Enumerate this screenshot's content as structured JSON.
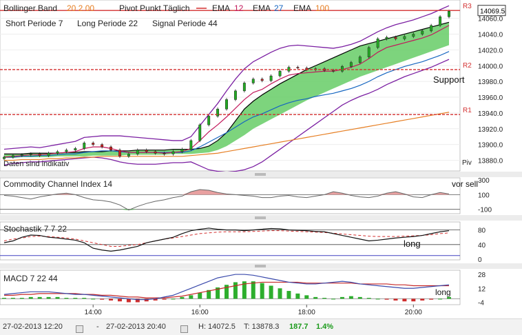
{
  "header": {
    "bollinger_label": "Bollinger Band",
    "bollinger_params": "20  2.00",
    "pivot_label": "Pivot Punkt  Täglich",
    "ema_labels": [
      "EMA",
      "EMA",
      "EMA"
    ],
    "ema_values": [
      "12",
      "27",
      "100"
    ],
    "params_line": [
      "Short Periode  7",
      "Long Periode  22",
      "Signal Periode  44"
    ],
    "indicative_note": "Daten sind indikativ",
    "piv_label": "Piv"
  },
  "colors": {
    "up_candle": "#22aa22",
    "down_candle": "#cc2222",
    "cloud": "#66cc66",
    "bollinger": "#7b1fa2",
    "pivot": "#d32f2f",
    "ema12": "#c2185b",
    "ema27": "#1565c0",
    "ema100": "#e67e22",
    "cci_fill": "#e8a0a0",
    "macd_pos": "#22aa22",
    "macd_neg": "#cc2222"
  },
  "chart_data": [
    {
      "type": "line",
      "name_hint": "price",
      "x_ticks": [
        "14:00",
        "16:00",
        "18:00",
        "20:00"
      ],
      "y_ticks": [
        "14060.0",
        "14040.0",
        "14020.0",
        "14000.0",
        "13980.0",
        "13960.0",
        "13940.0",
        "13920.0",
        "13900.0",
        "13880.0"
      ],
      "ylim": [
        13870,
        14078
      ],
      "last_price": "14069.5",
      "pivot_levels": [
        {
          "label": "R3",
          "value": 14070
        },
        {
          "label": "R2",
          "value": 13995
        },
        {
          "label": "R1",
          "value": 13938
        }
      ],
      "annotations": [
        "Support"
      ],
      "x_time": [
        "12:20",
        "12:30",
        "12:40",
        "12:50",
        "13:00",
        "13:10",
        "13:20",
        "13:30",
        "13:40",
        "13:50",
        "14:00",
        "14:10",
        "14:20",
        "14:30",
        "14:40",
        "14:50",
        "15:00",
        "15:10",
        "15:20",
        "15:30",
        "15:40",
        "15:50",
        "16:00",
        "16:10",
        "16:20",
        "16:30",
        "16:40",
        "16:50",
        "17:00",
        "17:10",
        "17:20",
        "17:30",
        "17:40",
        "17:50",
        "18:00",
        "18:10",
        "18:20",
        "18:30",
        "18:40",
        "18:50",
        "19:00",
        "19:10",
        "19:20",
        "19:30",
        "19:40",
        "19:50",
        "20:00",
        "20:10",
        "20:20",
        "20:30",
        "20:40"
      ],
      "close": [
        13884,
        13886,
        13887,
        13888,
        13886,
        13889,
        13891,
        13893,
        13895,
        13902,
        13900,
        13897,
        13893,
        13885,
        13888,
        13893,
        13891,
        13889,
        13888,
        13891,
        13894,
        13905,
        13925,
        13936,
        13945,
        13957,
        13968,
        13978,
        13983,
        13981,
        13987,
        13993,
        13998,
        13997,
        13995,
        13996,
        13994,
        13993,
        13999,
        14004,
        14011,
        14023,
        14034,
        14036,
        14034,
        14037,
        14040,
        14044,
        14051,
        14062,
        14069
      ],
      "ema12": [
        13884,
        13885,
        13886,
        13887,
        13887,
        13888,
        13889,
        13890,
        13891,
        13895,
        13897,
        13897,
        13895,
        13892,
        13890,
        13890,
        13890,
        13890,
        13889,
        13890,
        13891,
        13895,
        13905,
        13916,
        13925,
        13935,
        13946,
        13957,
        13966,
        13970,
        13977,
        13983,
        13988,
        13990,
        13991,
        13992,
        13993,
        13993,
        13995,
        13998,
        14002,
        14009,
        14017,
        14023,
        14026,
        14029,
        14032,
        14035,
        14039,
        14045,
        14051
      ],
      "ema27": [
        13884,
        13884,
        13885,
        13885,
        13886,
        13886,
        13887,
        13888,
        13888,
        13890,
        13891,
        13892,
        13892,
        13891,
        13890,
        13890,
        13890,
        13890,
        13890,
        13890,
        13890,
        13892,
        13897,
        13903,
        13909,
        13915,
        13922,
        13929,
        13935,
        13939,
        13944,
        13949,
        13953,
        13956,
        13958,
        13961,
        13963,
        13965,
        13968,
        13971,
        13975,
        13980,
        13986,
        13991,
        13995,
        13999,
        14002,
        14005,
        14009,
        14013,
        14018
      ],
      "ema100": [
        13880,
        13880,
        13881,
        13881,
        13881,
        13882,
        13882,
        13883,
        13883,
        13884,
        13884,
        13885,
        13885,
        13885,
        13885,
        13885,
        13885,
        13885,
        13885,
        13885,
        13885,
        13886,
        13887,
        13888,
        13889,
        13891,
        13893,
        13895,
        13897,
        13899,
        13901,
        13903,
        13905,
        13907,
        13909,
        13911,
        13913,
        13915,
        13917,
        13919,
        13921,
        13923,
        13925,
        13927,
        13929,
        13931,
        13933,
        13935,
        13937,
        13939,
        13941
      ],
      "boll_upper": [
        13894,
        13895,
        13896,
        13897,
        13896,
        13898,
        13900,
        13902,
        13904,
        13909,
        13910,
        13911,
        13911,
        13911,
        13910,
        13909,
        13908,
        13907,
        13906,
        13905,
        13905,
        13910,
        13924,
        13938,
        13952,
        13968,
        13983,
        13996,
        14005,
        14011,
        14017,
        14022,
        14025,
        14026,
        14025,
        14024,
        14023,
        14022,
        14024,
        14027,
        14031,
        14037,
        14043,
        14048,
        14052,
        14055,
        14058,
        14062,
        14066,
        14071,
        14076
      ],
      "boll_lower": [
        13874,
        13876,
        13877,
        13878,
        13878,
        13879,
        13880,
        13881,
        13882,
        13883,
        13884,
        13883,
        13881,
        13878,
        13876,
        13875,
        13875,
        13875,
        13876,
        13877,
        13877,
        13878,
        13873,
        13868,
        13866,
        13865,
        13866,
        13868,
        13872,
        13878,
        13886,
        13894,
        13902,
        13910,
        13918,
        13926,
        13934,
        13942,
        13950,
        13956,
        13961,
        13965,
        13970,
        13976,
        13981,
        13986,
        13990,
        13994,
        13998,
        14003,
        14008
      ],
      "cloud_top": [
        13888,
        13888,
        13888,
        13889,
        13889,
        13889,
        13889,
        13890,
        13890,
        13891,
        13891,
        13891,
        13892,
        13892,
        13892,
        13893,
        13893,
        13893,
        13893,
        13894,
        13894,
        13894,
        13895,
        13898,
        13905,
        13915,
        13930,
        13945,
        13955,
        13963,
        13970,
        13977,
        13983,
        13989,
        13995,
        14000,
        14005,
        14010,
        14015,
        14020,
        14025,
        14028,
        14031,
        14034,
        14037,
        14040,
        14043,
        14046,
        14049,
        14052,
        14055
      ],
      "cloud_bottom": [
        13883,
        13883,
        13884,
        13884,
        13884,
        13884,
        13885,
        13885,
        13885,
        13885,
        13886,
        13886,
        13886,
        13886,
        13887,
        13887,
        13887,
        13887,
        13887,
        13888,
        13888,
        13888,
        13889,
        13890,
        13893,
        13898,
        13905,
        13912,
        13920,
        13926,
        13932,
        13938,
        13944,
        13950,
        13956,
        13961,
        13966,
        13971,
        13976,
        13981,
        13986,
        13990,
        13994,
        13998,
        14002,
        14006,
        14010,
        14014,
        14018,
        14022,
        14026
      ]
    },
    {
      "type": "area",
      "title": "Commodity Channel Index  14",
      "y_ticks": [
        "300",
        "100",
        "-100"
      ],
      "ylim": [
        -150,
        320
      ],
      "annotation": "vor sell",
      "values": [
        90,
        80,
        60,
        40,
        70,
        90,
        110,
        120,
        100,
        60,
        30,
        20,
        0,
        -40,
        -110,
        -60,
        -20,
        10,
        30,
        60,
        80,
        140,
        170,
        160,
        130,
        110,
        100,
        90,
        80,
        60,
        60,
        80,
        90,
        70,
        60,
        80,
        100,
        140,
        120,
        90,
        70,
        60,
        80,
        120,
        140,
        110,
        70,
        60,
        100,
        130,
        110
      ]
    },
    {
      "type": "line",
      "title": "Stochastik  7  7  22",
      "y_ticks": [
        "80",
        "40",
        "0"
      ],
      "ylim": [
        0,
        100
      ],
      "annotation": "long",
      "series": [
        {
          "values": [
            45,
            50,
            60,
            66,
            65,
            60,
            58,
            55,
            52,
            45,
            30,
            25,
            22,
            25,
            30,
            35,
            45,
            50,
            55,
            60,
            70,
            78,
            82,
            85,
            82,
            80,
            80,
            78,
            80,
            82,
            84,
            83,
            80,
            79,
            78,
            76,
            75,
            70,
            65,
            60,
            55,
            50,
            52,
            55,
            58,
            60,
            62,
            65,
            70,
            75,
            78
          ]
        },
        {
          "values": [
            50,
            55,
            58,
            62,
            63,
            62,
            60,
            58,
            55,
            50,
            45,
            40,
            35,
            35,
            38,
            40,
            45,
            50,
            55,
            58,
            62,
            66,
            70,
            72,
            74,
            75,
            75,
            75,
            76,
            77,
            78,
            78,
            77,
            76,
            75,
            74,
            73,
            71,
            69,
            67,
            65,
            63,
            62,
            62,
            62,
            63,
            64,
            65,
            67,
            70,
            72
          ]
        }
      ]
    },
    {
      "type": "bar",
      "title": "MACD  7  22  44",
      "y_ticks": [
        "28",
        "12",
        "-4"
      ],
      "ylim": [
        -6,
        32
      ],
      "annotation": "long",
      "histogram": [
        1,
        1,
        1,
        2,
        2,
        2,
        2,
        1,
        1,
        1,
        0,
        -1,
        -2,
        -3,
        -4,
        -4,
        -3,
        -2,
        -1,
        0,
        2,
        4,
        7,
        10,
        13,
        16,
        19,
        20,
        20,
        18,
        15,
        12,
        9,
        6,
        4,
        2,
        1,
        0,
        2,
        3,
        2,
        1,
        0,
        -1,
        -2,
        -3,
        -3,
        -2,
        -1,
        0,
        2
      ],
      "macd_line": [
        5,
        6,
        7,
        8,
        8,
        8,
        7,
        6,
        5,
        5,
        4,
        3,
        2,
        1,
        0,
        -1,
        -1,
        0,
        2,
        4,
        8,
        12,
        16,
        20,
        24,
        26,
        28,
        28,
        27,
        25,
        23,
        21,
        19,
        18,
        17,
        17,
        18,
        19,
        20,
        19,
        17,
        16,
        15,
        14,
        13,
        12,
        12,
        13,
        14,
        15,
        16
      ],
      "signal_line": [
        4,
        4,
        5,
        5,
        6,
        6,
        6,
        6,
        6,
        5,
        5,
        4,
        4,
        3,
        2,
        2,
        1,
        1,
        1,
        2,
        3,
        5,
        7,
        9,
        11,
        13,
        15,
        17,
        18,
        19,
        19,
        19,
        19,
        19,
        18,
        18,
        18,
        18,
        18,
        18,
        17,
        17,
        17,
        17,
        16,
        16,
        15,
        15,
        15,
        15,
        15
      ]
    }
  ],
  "status_bar": {
    "start_date": "27-02-2013 12:20",
    "separator": "-",
    "end_date": "27-02-2013 20:40",
    "high": "H: 14072.5",
    "low": "T: 13878.3",
    "change": "187.7",
    "change_pct": "1.4%"
  }
}
